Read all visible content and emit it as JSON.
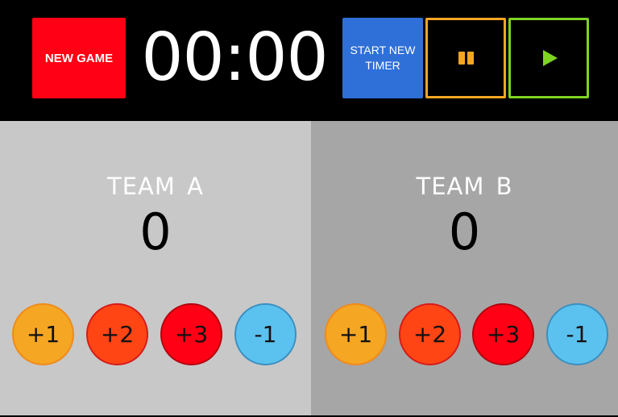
{
  "toolbar": {
    "new_game_label": "NEW GAME",
    "timer_value": "00:00",
    "start_timer_label": "START NEW TIMER",
    "pause_icon": "pause-icon",
    "play_icon": "play-icon"
  },
  "teams": [
    {
      "name": "TEAM A",
      "score": "0",
      "buttons": [
        "+1",
        "+2",
        "+3",
        "-1"
      ]
    },
    {
      "name": "TEAM B",
      "score": "0",
      "buttons": [
        "+1",
        "+2",
        "+3",
        "-1"
      ]
    }
  ],
  "colors": {
    "new_game": "#ff0014",
    "start_timer": "#2f6fd8",
    "pause_border": "#f5a623",
    "play_border": "#7ed321",
    "plus1": "#f5a623",
    "plus2": "#ff4514",
    "plus3": "#ff0014",
    "minus1": "#5bc2f0",
    "team_a_bg": "#c8c8c8",
    "team_b_bg": "#a6a6a6"
  }
}
